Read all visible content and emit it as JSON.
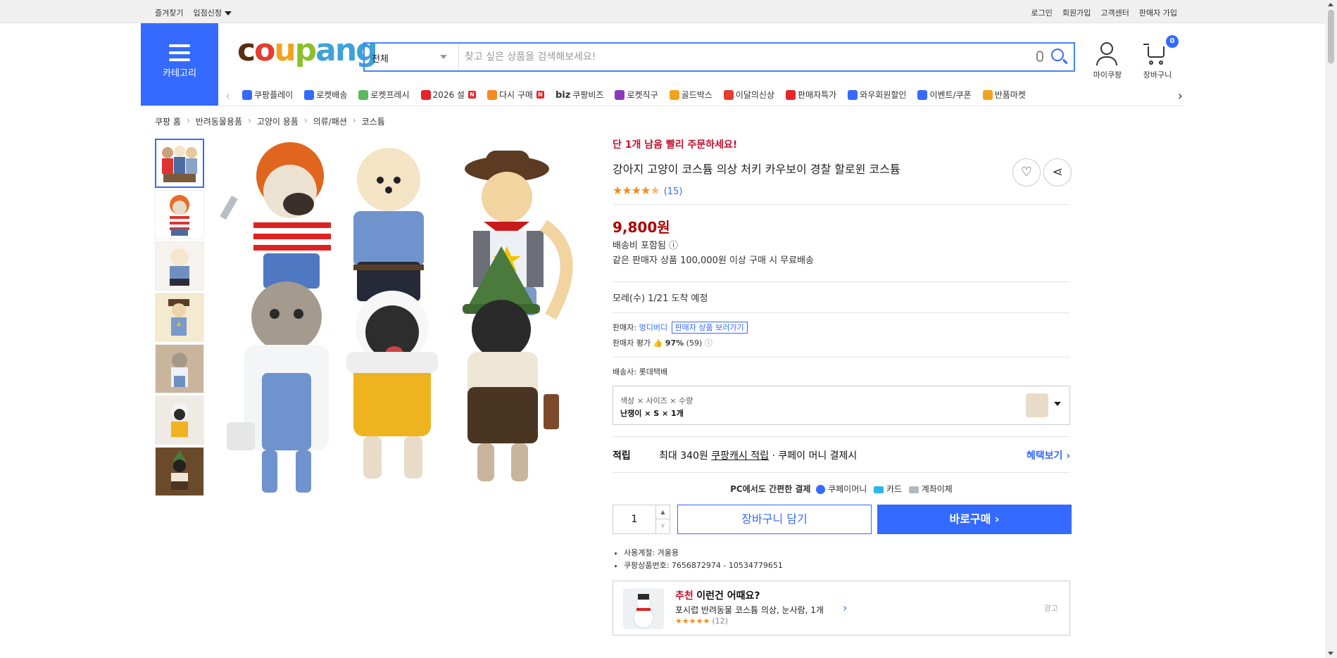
{
  "topbar": {
    "left": [
      "즐겨찾기",
      "입점신청"
    ],
    "right": [
      "로그인",
      "회원가입",
      "고객센터",
      "판매자 가입"
    ]
  },
  "category": {
    "label": "카테고리"
  },
  "logo": {
    "parts": [
      "c",
      "o",
      "u",
      "p",
      "ang"
    ]
  },
  "search": {
    "category": "전체",
    "placeholder": "찾고 싶은 상품을 검색해보세요!"
  },
  "header_icons": {
    "mycoupang": "마이쿠팡",
    "cart": "장바구니",
    "cart_count": "0"
  },
  "gnb": {
    "items": [
      {
        "label": "쿠팡플레이",
        "icon": "play-icon",
        "color": "#346aff"
      },
      {
        "label": "로켓배송",
        "icon": "rocket-icon",
        "color": "#346aff"
      },
      {
        "label": "로켓프레시",
        "icon": "rocket-fresh-icon",
        "color": "#5cb85c"
      },
      {
        "label": "2026 설",
        "icon": "gift-icon",
        "color": "#e52528",
        "badge": "N"
      },
      {
        "label": "다시 구매",
        "icon": "basket-icon",
        "color": "#f58a1f",
        "badge": "N"
      },
      {
        "label": "쿠팡비즈",
        "icon": "biz-icon",
        "color": "#333333",
        "prefix": "biz"
      },
      {
        "label": "로켓직구",
        "icon": "global-icon",
        "color": "#8a3ab9"
      },
      {
        "label": "골드박스",
        "icon": "goldbox-icon",
        "color": "#f0a31c"
      },
      {
        "label": "이달의신상",
        "icon": "bag-icon",
        "color": "#e53c2e"
      },
      {
        "label": "판매자특가",
        "icon": "sale-icon",
        "color": "#e52528"
      },
      {
        "label": "와우회원할인",
        "icon": "wow-icon",
        "color": "#346aff"
      },
      {
        "label": "이벤트/쿠폰",
        "icon": "coupon-icon",
        "color": "#346aff"
      },
      {
        "label": "반품마켓",
        "icon": "market-icon",
        "color": "#f0a31c"
      }
    ]
  },
  "breadcrumb": [
    "쿠팡 홈",
    "반려동물용품",
    "고양이 용품",
    "의류/패션",
    "코스튬"
  ],
  "product": {
    "rush": "단 1개 남음 빨리 주문하세요!",
    "title": "강아지 고양이 코스튬 의상 처키 카우보이 경찰 할로윈 코스튬",
    "rating_stars": 4.5,
    "review_count": "(15)",
    "price": "9,800원",
    "shipping": "배송비 포함됨 ⓘ",
    "free_shipping": "같은 판매자 상품 100,000원 이상 구매 시 무료배송",
    "delivery": "모레(수) 1/21 도착 예정",
    "seller_label": "판매자:",
    "seller_name": "멍디버디",
    "seller_link": "판매자 상품 보러가기",
    "seller_rating_label": "판매자 평가",
    "seller_rating_pct": "97%",
    "seller_rating_count": "(59)",
    "courier_label": "배송사:",
    "courier": "롯데택배",
    "option_header": "색상 × 사이즈 × 수량",
    "option_value": "난쟁이 × S × 1개",
    "reward_label": "적립",
    "reward_text_pre": "최대 340원",
    "reward_link": "쿠팡캐시 적립",
    "reward_text_post": "· 쿠페이 머니 결제시",
    "reward_more": "혜택보기 ›",
    "pay_title": "PC에서도 간편한 결제",
    "pay_methods": [
      "쿠페이머니",
      "카드",
      "계좌이체"
    ],
    "qty": "1",
    "btn_cart": "장바구니 담기",
    "btn_buy": "바로구매 ›",
    "spec_season": "사용계절: 겨울용",
    "spec_id": "쿠팡상품번호: 7656872974 - 10534779651",
    "reco_tag": "추천",
    "reco_title": "이런건 어때요?",
    "reco_name": "포시럽 반려동물 코스튬 의상, 눈사람, 1개",
    "reco_count": "(12)",
    "reco_ad": "광고"
  },
  "colors": {
    "accent": "#346aff",
    "price": "#ae0000",
    "rush": "#c8102e",
    "star": "#f58a1f"
  }
}
